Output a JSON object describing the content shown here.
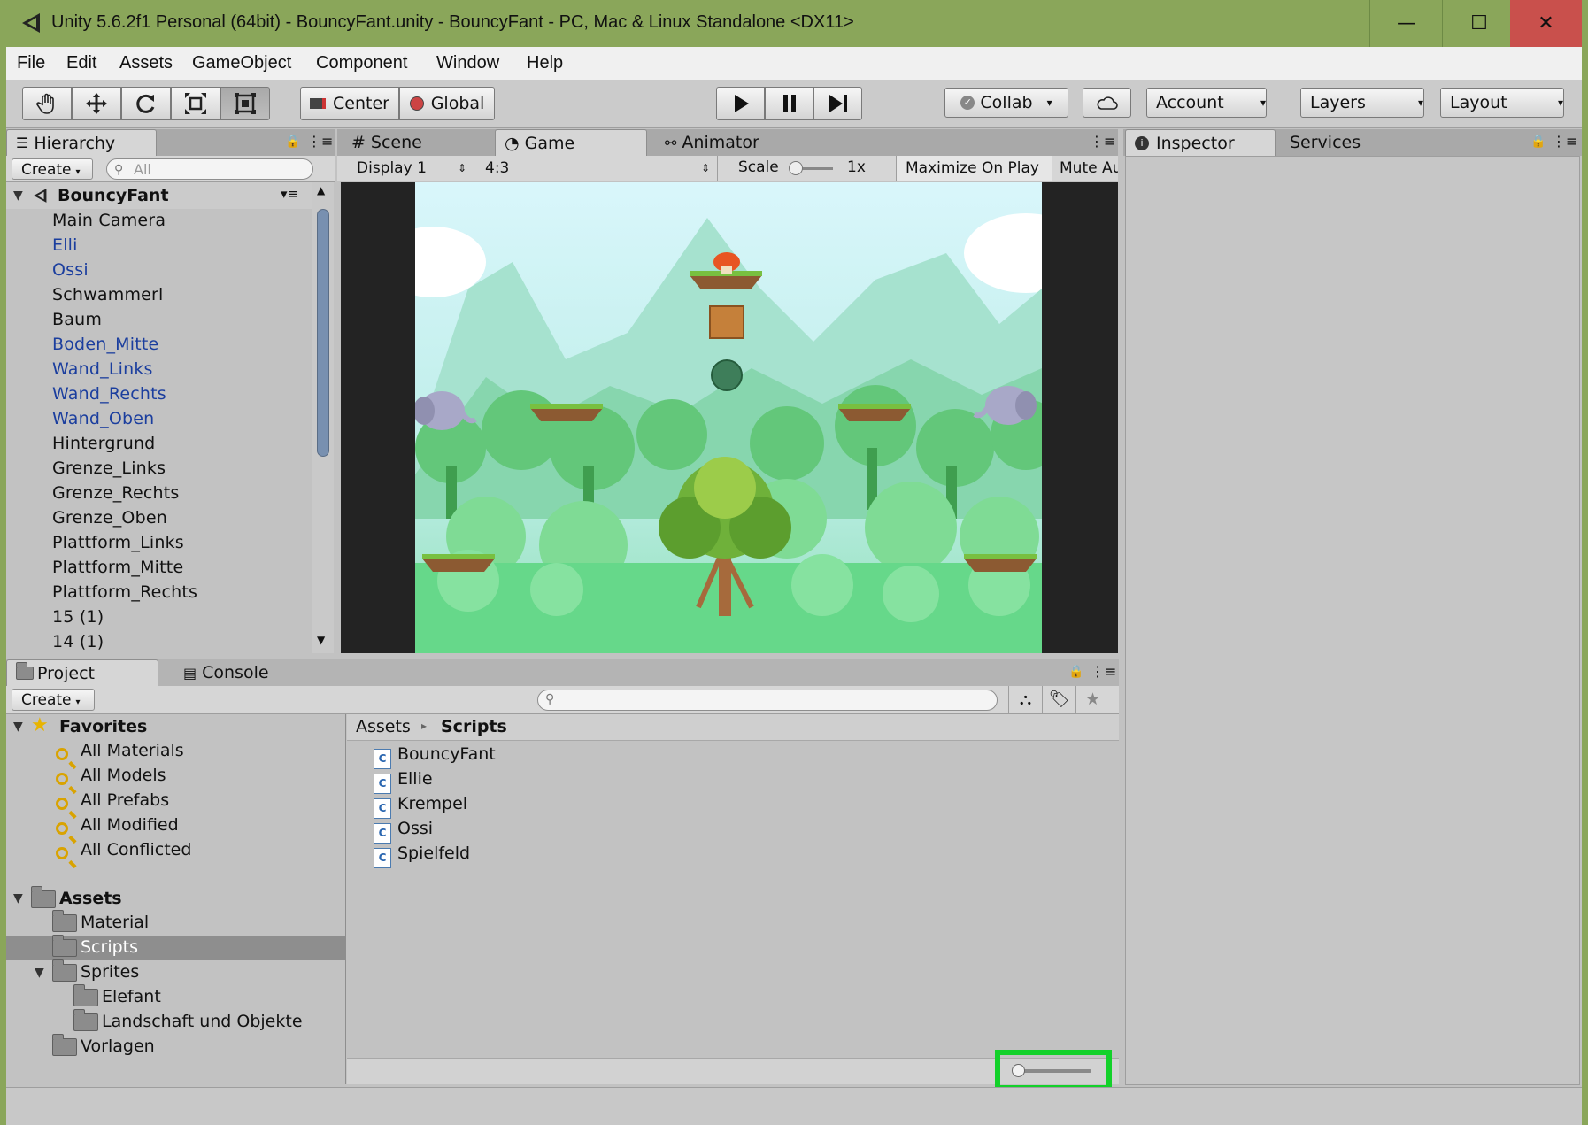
{
  "window": {
    "title": "Unity 5.6.2f1 Personal (64bit) - BouncyFant.unity - BouncyFant - PC, Mac & Linux Standalone <DX11>",
    "minimize_label": "—",
    "maximize_label": "☐",
    "close_label": "✕"
  },
  "menu": [
    "File",
    "Edit",
    "Assets",
    "GameObject",
    "Component",
    "Window",
    "Help"
  ],
  "toolbar": {
    "center_label": "Center",
    "global_label": "Global",
    "collab_label": "Collab",
    "account_label": "Account",
    "layers_label": "Layers",
    "layout_label": "Layout"
  },
  "hierarchy": {
    "tab_label": "Hierarchy",
    "create_label": "Create",
    "search_placeholder": "All",
    "scene_name": "BouncyFant",
    "items": [
      {
        "label": "Main Camera",
        "prefab": false
      },
      {
        "label": "Elli",
        "prefab": true
      },
      {
        "label": "Ossi",
        "prefab": true
      },
      {
        "label": "Schwammerl",
        "prefab": false
      },
      {
        "label": "Baum",
        "prefab": false
      },
      {
        "label": "Boden_Mitte",
        "prefab": true
      },
      {
        "label": "Wand_Links",
        "prefab": true
      },
      {
        "label": "Wand_Rechts",
        "prefab": true
      },
      {
        "label": "Wand_Oben",
        "prefab": true
      },
      {
        "label": "Hintergrund",
        "prefab": false
      },
      {
        "label": "Grenze_Links",
        "prefab": false
      },
      {
        "label": "Grenze_Rechts",
        "prefab": false
      },
      {
        "label": "Grenze_Oben",
        "prefab": false
      },
      {
        "label": "Plattform_Links",
        "prefab": false
      },
      {
        "label": "Plattform_Mitte",
        "prefab": false
      },
      {
        "label": "Plattform_Rechts",
        "prefab": false
      },
      {
        "label": "15 (1)",
        "prefab": false
      },
      {
        "label": "14 (1)",
        "prefab": false
      }
    ]
  },
  "game_view": {
    "tabs": [
      "Scene",
      "Game",
      "Animator"
    ],
    "display": "Display 1",
    "aspect": "4:3",
    "scale_label": "Scale",
    "scale_value": "1x",
    "maximize_label": "Maximize On Play",
    "mute_label": "Mute Au"
  },
  "inspector": {
    "tab_label": "Inspector",
    "services_label": "Services"
  },
  "project": {
    "tab_label": "Project",
    "console_label": "Console",
    "create_label": "Create",
    "favorites_label": "Favorites",
    "favorites": [
      "All Materials",
      "All Models",
      "All Prefabs",
      "All Modified",
      "All Conflicted"
    ],
    "assets_label": "Assets",
    "folders": [
      "Material",
      "Scripts",
      "Sprites",
      "Elefant",
      "Landschaft und Objekte",
      "Vorlagen"
    ],
    "breadcrumb": [
      "Assets",
      "Scripts"
    ],
    "scripts": [
      "BouncyFant",
      "Ellie",
      "Krempel",
      "Ossi",
      "Spielfeld"
    ],
    "zoom_slider_value": 0
  },
  "colors": {
    "prefab_text": "#1b3e9e",
    "highlight_box": "#13d12a",
    "titlebar": "#8aa65a",
    "close_button": "#c9504c"
  }
}
